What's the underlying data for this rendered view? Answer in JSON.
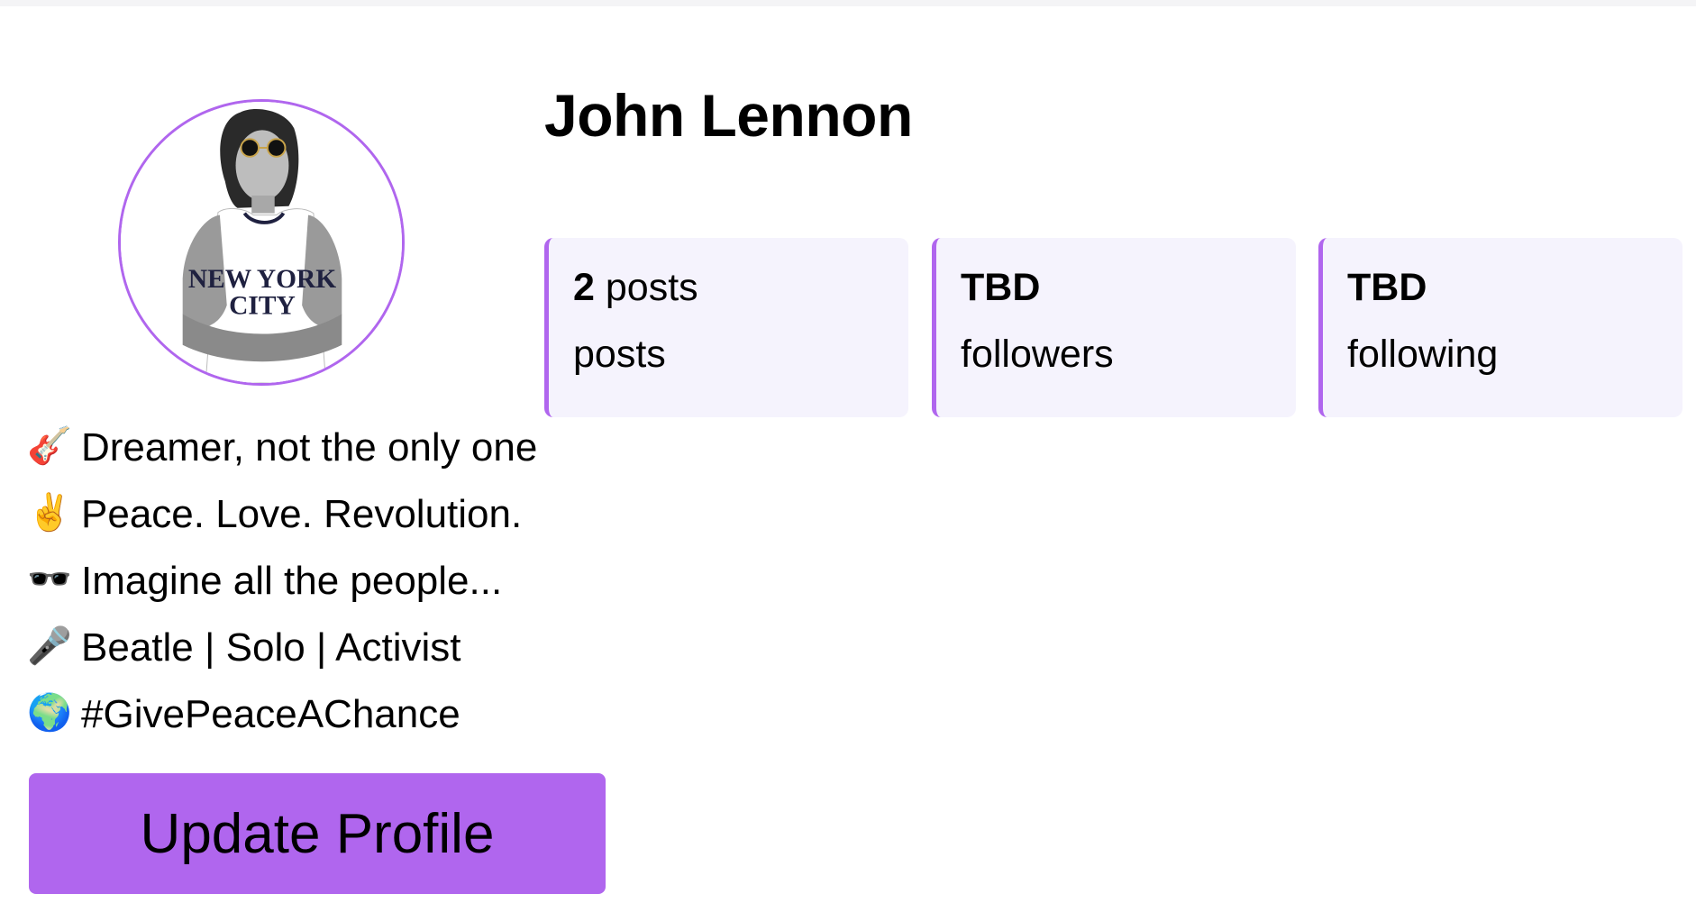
{
  "profile": {
    "name": "John Lennon",
    "avatar_alt": "John Lennon avatar",
    "accent_color": "#b066ee"
  },
  "stats": [
    {
      "value": "2",
      "value_suffix": " posts",
      "label": "posts"
    },
    {
      "value": "TBD",
      "value_suffix": "",
      "label": "followers"
    },
    {
      "value": "TBD",
      "value_suffix": "",
      "label": "following"
    }
  ],
  "bio": [
    {
      "icon": "guitar-icon",
      "glyph": "🎸",
      "text": "Dreamer, not the only one"
    },
    {
      "icon": "peace-hand-icon",
      "glyph": "✌️",
      "text": "Peace. Love. Revolution."
    },
    {
      "icon": "sunglasses-icon",
      "glyph": "🕶️",
      "text": "Imagine all the people..."
    },
    {
      "icon": "microphone-icon",
      "glyph": "🎤",
      "text": "Beatle | Solo | Activist"
    },
    {
      "icon": "globe-icon",
      "glyph": "🌍",
      "text": "#GivePeaceAChance"
    }
  ],
  "actions": {
    "update_label": "Update Profile"
  }
}
